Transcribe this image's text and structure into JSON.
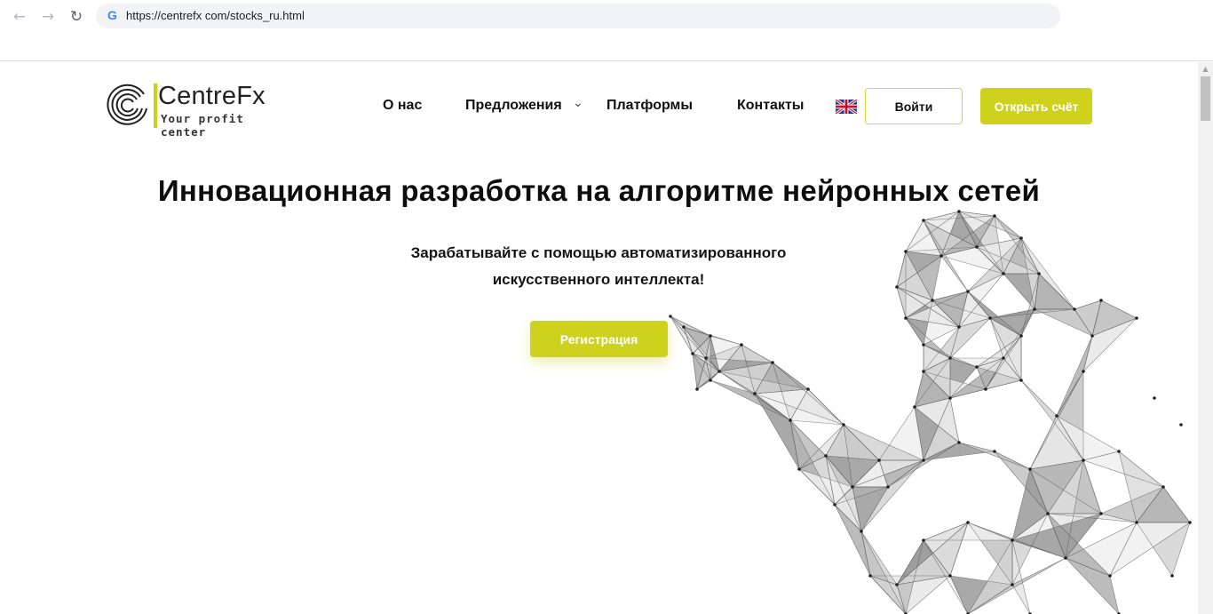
{
  "browser": {
    "url": "https://centrefx com/stocks_ru.html",
    "back_icon": "arrow-left-icon",
    "forward_icon": "arrow-right-icon",
    "reload_icon": "reload-icon",
    "favicon_letter": "G"
  },
  "site": {
    "logo": {
      "name": "CentreFx",
      "tagline": "Your profit center"
    },
    "nav": [
      {
        "label": "О нас"
      },
      {
        "label": "Предложения"
      },
      {
        "label": "Платформы"
      },
      {
        "label": "Контакты"
      }
    ],
    "language_icon": "uk-flag-icon",
    "login_label": "Войти",
    "open_account_label": "Открыть счёт"
  },
  "hero": {
    "title": "Инновационная разработка на алгоритме нейронных сетей",
    "subtitle_line1": "Зарабатывайте с помощью автоматизированного",
    "subtitle_line2": "искусственного интеллекта!",
    "register_label": "Регистрация"
  },
  "colors": {
    "accent": "#cfd21c",
    "text": "#111111"
  }
}
